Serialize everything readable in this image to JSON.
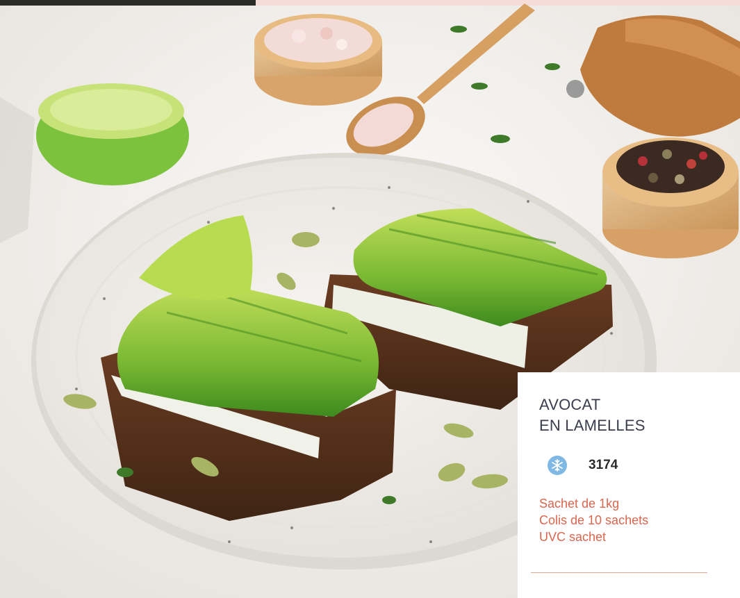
{
  "product": {
    "title_line1": "AVOCAT",
    "title_line2": "EN LAMELLES",
    "storage_icon": "snowflake-icon",
    "code": "3174",
    "details": [
      "Sachet de 1kg",
      "Colis de 10 sachets",
      "UVC sachet"
    ]
  },
  "colors": {
    "title": "#3a3d4c",
    "details": "#d9664e",
    "snowflake_badge": "#7fb9e3",
    "rule": "#e3a491"
  }
}
